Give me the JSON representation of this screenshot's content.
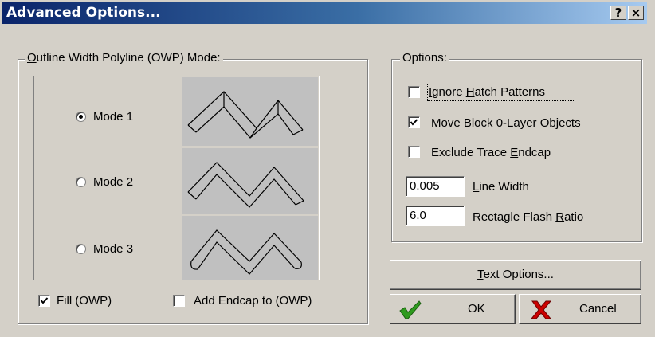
{
  "window": {
    "title": "Advanced Options...",
    "help_glyph": "?",
    "close_glyph": "×"
  },
  "owp_group": {
    "legend_ul": "O",
    "legend_rest": "utline Width Polyline (OWP) Mode:",
    "modes": [
      {
        "label": "Mode 1",
        "selected": true
      },
      {
        "label": "Mode 2",
        "selected": false
      },
      {
        "label": "Mode 3",
        "selected": false
      }
    ],
    "fill": {
      "label": "Fill (OWP)",
      "checked": true
    },
    "endcap": {
      "label": "Add Endcap to (OWP)",
      "checked": false
    }
  },
  "options_group": {
    "legend": "Options:",
    "ignore_hatch": {
      "pre": "I",
      "pre_rest": "gnore ",
      "ul": "H",
      "rest": "atch Patterns",
      "checked": false
    },
    "move_block": {
      "label": "Move Block 0-Layer Objects",
      "checked": true
    },
    "exclude_trace": {
      "pre": "Exclude Trace ",
      "ul": "E",
      "rest": "ndcap",
      "checked": false
    },
    "line_width": {
      "value": "0.005",
      "ul": "L",
      "rest": "ine Width"
    },
    "flash_ratio": {
      "value": "6.0",
      "pre": "Rectagle Flash ",
      "ul": "R",
      "rest": "atio"
    }
  },
  "buttons": {
    "text_options": {
      "ul": "T",
      "rest": "ext Options..."
    },
    "ok": "OK",
    "cancel": "Cancel"
  },
  "colors": {
    "title_start": "#0a246a",
    "title_end": "#a6caf0",
    "face": "#d4d0c8",
    "preview": "#c0c0c0",
    "ok_check": "#2e9a1e",
    "cancel_x": "#cc0000"
  }
}
